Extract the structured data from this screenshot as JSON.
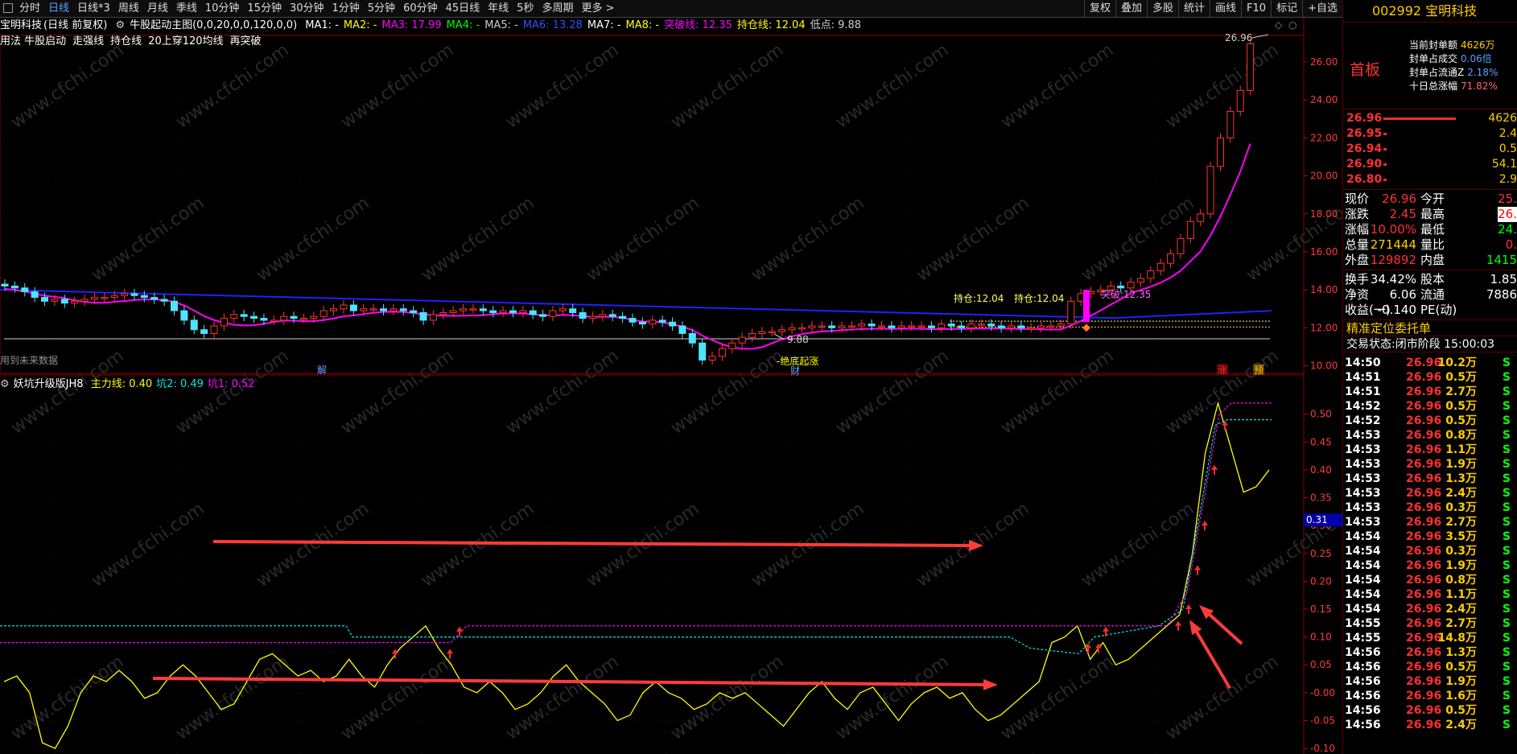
{
  "tabs": [
    "分时",
    "日线",
    "日线*3",
    "周线",
    "月线",
    "季线",
    "10分钟",
    "15分钟",
    "30分钟",
    "1分钟",
    "5分钟",
    "60分钟",
    "45日线",
    "年线",
    "5秒",
    "多周期",
    "更多 >"
  ],
  "active_tab": "日线",
  "toolbar_right": [
    "复权",
    "叠加",
    "多股",
    "统计",
    "画线",
    "F10",
    "标记",
    "+自选"
  ],
  "main_indicator": {
    "stock": "宝明科技",
    "mode": "(日线 前复权)",
    "name": "牛股起动主图(0,0,20,0,0,120,0,0)",
    "items": [
      {
        "label": "MA1:",
        "value": " -",
        "color": "#ffffff"
      },
      {
        "label": "MA2:",
        "value": " -",
        "color": "#ffff00"
      },
      {
        "label": "MA3:",
        "value": " 17.99",
        "color": "#ff00ff"
      },
      {
        "label": "MA4:",
        "value": " -",
        "color": "#00ff00"
      },
      {
        "label": "MA5:",
        "value": " -",
        "color": "#cfcfcf"
      },
      {
        "label": "MA6:",
        "value": " 13.28",
        "color": "#3050ff"
      },
      {
        "label": "MA7:",
        "value": " -",
        "color": "#ffffff"
      },
      {
        "label": "MA8:",
        "value": " -",
        "color": "#ffff00"
      },
      {
        "label": "突破线:",
        "value": " 12.35",
        "color": "#ff00ff"
      },
      {
        "label": "持仓线:",
        "value": " 12.04",
        "color": "#ffff00"
      },
      {
        "label": "低点:",
        "value": " 9.88",
        "color": "#cfcfcf"
      }
    ]
  },
  "usage_labels": [
    "用法 牛股启动",
    "走强线",
    "持仓线",
    "20上穿120均线",
    "再突破"
  ],
  "annotations": {
    "high_price": "26.96",
    "low_price": "9.88",
    "hold_line": "持仓:12.04",
    "hold_line_b": "持仓:12.04",
    "break_line": "突破:12.35",
    "future_data": "用到未来数据",
    "bottom_rise": "-绝底起涨",
    "marker_jie": "解",
    "marker_cai": "财",
    "marker_zhang": "涨",
    "marker_yu": "预",
    "cur_sub_value": "0.31"
  },
  "sub_indicator": {
    "name": "妖坑升级版JH8",
    "items": [
      {
        "label": "主力线:",
        "value": " 0.40",
        "color": "#ffff00"
      },
      {
        "label": "坑2:",
        "value": " 0.49",
        "color": "#00e5e5"
      },
      {
        "label": "坑1:",
        "value": " 0.52",
        "color": "#ff00ff"
      }
    ]
  },
  "watermark": "www.cfchi.com",
  "chart_data": [
    {
      "type": "candlestick",
      "title": "牛股起动主图",
      "y_ticks": [
        "26.00",
        "24.00",
        "22.00",
        "20.00",
        "18.00",
        "16.00",
        "14.00",
        "12.00",
        "10.00"
      ],
      "ylim": [
        9.6,
        27.4
      ],
      "last_close": 26.96,
      "low": 9.88,
      "hold_line": 12.04,
      "break_line": 12.35
    },
    {
      "type": "line",
      "title": "妖坑升级版JH8",
      "y_ticks": [
        "0.50",
        "0.45",
        "0.40",
        "0.35",
        "0.30",
        "0.25",
        "0.20",
        "0.15",
        "0.10",
        "0.05",
        "-0.00",
        "-0.05",
        "-0.10"
      ],
      "ylim": [
        -0.11,
        0.54
      ],
      "series": [
        {
          "name": "主力线",
          "last": 0.4,
          "color": "#ffff00"
        },
        {
          "name": "坑2",
          "last": 0.49,
          "color": "#00e5e5"
        },
        {
          "name": "坑1",
          "last": 0.52,
          "color": "#ff00ff"
        }
      ]
    }
  ],
  "side": {
    "code": "002992",
    "name": "宝明科技",
    "status_big": "首板",
    "seal_info": [
      {
        "label": "当前封单额",
        "value": "4626万",
        "color": "#ffcc00"
      },
      {
        "label": "封单占成交",
        "value": "0.06倍",
        "color": "#5aa0ff"
      },
      {
        "label": "封单占流通Z",
        "value": "2.18%",
        "color": "#5aa0ff"
      },
      {
        "label": "十日总涨幅",
        "value": "71.82%",
        "color": "#ff6666"
      }
    ],
    "orderbook": [
      {
        "price": "26.96",
        "vol": "4626",
        "fill": 1.0
      },
      {
        "price": "26.95",
        "vol": "2.4",
        "fill": 0.02
      },
      {
        "price": "26.94",
        "vol": "0.5",
        "fill": 0.02
      },
      {
        "price": "26.90",
        "vol": "54.1",
        "fill": 0.02
      },
      {
        "price": "26.80",
        "vol": "2.9",
        "fill": 0.02
      }
    ],
    "quotes": [
      {
        "l1": "现价",
        "v1": "26.96",
        "c1": "#ff3030",
        "l2": "今开",
        "v2": "25."
      },
      {
        "l1": "涨跌",
        "v1": "2.45",
        "c1": "#ff3030",
        "l2": "最高",
        "v2": "26.",
        "hl": true
      },
      {
        "l1": "涨幅",
        "v1": "10.00%",
        "c1": "#ff3030",
        "l2": "最低",
        "v2": "24.",
        "c2": "#00ff00"
      },
      {
        "l1": "总量",
        "v1": "271444",
        "c1": "#ffcc00",
        "l2": "量比",
        "v2": "0."
      },
      {
        "l1": "外盘",
        "v1": "129892",
        "c1": "#ff3030",
        "l2": "内盘",
        "v2": "1415",
        "c2": "#00ff00"
      }
    ],
    "quotes2": [
      {
        "l1": "换手",
        "v1": "34.42%",
        "l2": "股本",
        "v2": "1.85"
      },
      {
        "l1": "净资",
        "v1": "6.06",
        "l2": "流通",
        "v2": "7886"
      },
      {
        "l1": "收益(一)",
        "v1": "-0.140",
        "l2": "PE(动)",
        "v2": ""
      }
    ],
    "order_title": "精准定位委托单",
    "trade_status_label": "交易状态:",
    "trade_status": "闭市阶段",
    "trade_time": "15:00:03",
    "ticks": [
      {
        "t": "14:50",
        "p": "26.96",
        "v": "10.2万",
        "s": "S"
      },
      {
        "t": "14:51",
        "p": "26.96",
        "v": "0.5万",
        "s": "S"
      },
      {
        "t": "14:51",
        "p": "26.96",
        "v": "2.7万",
        "s": "S"
      },
      {
        "t": "14:52",
        "p": "26.96",
        "v": "0.5万",
        "s": "S"
      },
      {
        "t": "14:52",
        "p": "26.96",
        "v": "0.5万",
        "s": "S"
      },
      {
        "t": "14:53",
        "p": "26.96",
        "v": "0.8万",
        "s": "S"
      },
      {
        "t": "14:53",
        "p": "26.96",
        "v": "1.1万",
        "s": "S"
      },
      {
        "t": "14:53",
        "p": "26.96",
        "v": "1.9万",
        "s": "S"
      },
      {
        "t": "14:53",
        "p": "26.96",
        "v": "1.3万",
        "s": "S"
      },
      {
        "t": "14:53",
        "p": "26.96",
        "v": "2.4万",
        "s": "S"
      },
      {
        "t": "14:53",
        "p": "26.96",
        "v": "0.3万",
        "s": "S"
      },
      {
        "t": "14:53",
        "p": "26.96",
        "v": "2.7万",
        "s": "S"
      },
      {
        "t": "14:54",
        "p": "26.96",
        "v": "3.5万",
        "s": "S"
      },
      {
        "t": "14:54",
        "p": "26.96",
        "v": "0.3万",
        "s": "S"
      },
      {
        "t": "14:54",
        "p": "26.96",
        "v": "1.9万",
        "s": "S"
      },
      {
        "t": "14:54",
        "p": "26.96",
        "v": "0.8万",
        "s": "S"
      },
      {
        "t": "14:54",
        "p": "26.96",
        "v": "1.1万",
        "s": "S"
      },
      {
        "t": "14:54",
        "p": "26.96",
        "v": "2.4万",
        "s": "S"
      },
      {
        "t": "14:55",
        "p": "26.96",
        "v": "2.7万",
        "s": "S"
      },
      {
        "t": "14:55",
        "p": "26.96",
        "v": "14.8万",
        "s": "S"
      },
      {
        "t": "14:56",
        "p": "26.96",
        "v": "1.3万",
        "s": "S"
      },
      {
        "t": "14:56",
        "p": "26.96",
        "v": "0.5万",
        "s": "S"
      },
      {
        "t": "14:56",
        "p": "26.96",
        "v": "1.9万",
        "s": "S"
      },
      {
        "t": "14:56",
        "p": "26.96",
        "v": "1.6万",
        "s": "S"
      },
      {
        "t": "14:56",
        "p": "26.96",
        "v": "0.5万",
        "s": "S"
      },
      {
        "t": "14:56",
        "p": "26.96",
        "v": "2.4万",
        "s": "S"
      }
    ]
  }
}
